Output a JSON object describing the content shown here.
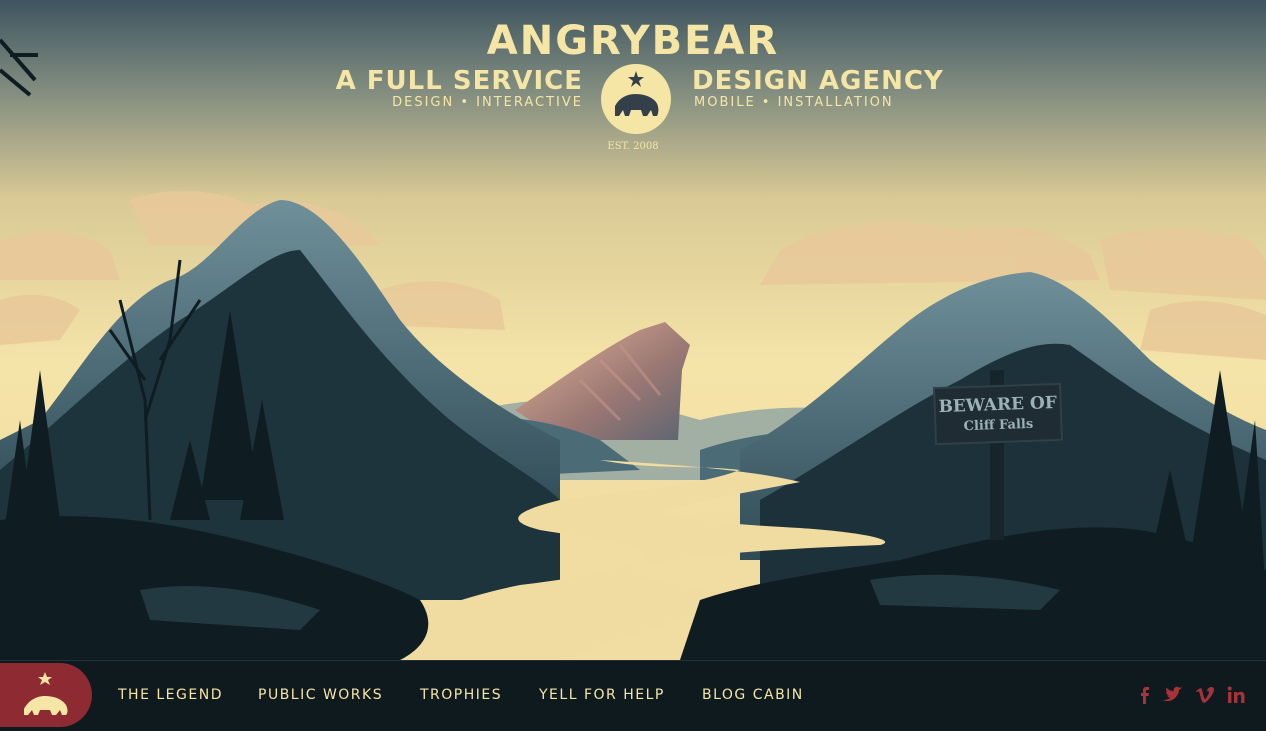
{
  "brand": {
    "title": "ANGRYBEAR",
    "tagline_left": "A FULL SERVICE",
    "tagline_right": "DESIGN AGENCY",
    "services_left": "DESIGN  •  INTERACTIVE",
    "services_right": "MOBILE  •  INSTALLATION",
    "established": "EST. 2008"
  },
  "sign": {
    "line1": "BEWARE OF",
    "line2": "Cliff Falls"
  },
  "nav": {
    "items": [
      {
        "label": "THE LEGEND"
      },
      {
        "label": "PUBLIC WORKS"
      },
      {
        "label": "TROPHIES"
      },
      {
        "label": "YELL FOR HELP"
      },
      {
        "label": "BLOG CABIN"
      }
    ]
  },
  "social": [
    "facebook-icon",
    "twitter-icon",
    "vimeo-icon",
    "linkedin-icon"
  ],
  "colors": {
    "cream": "#f6e6a6",
    "accent_red": "#8e2a32",
    "social_red": "#a8323a",
    "navbar_bg": "#0f1a1f",
    "sky_top": "#3e5560",
    "sky_bottom": "#f5e4a8"
  }
}
